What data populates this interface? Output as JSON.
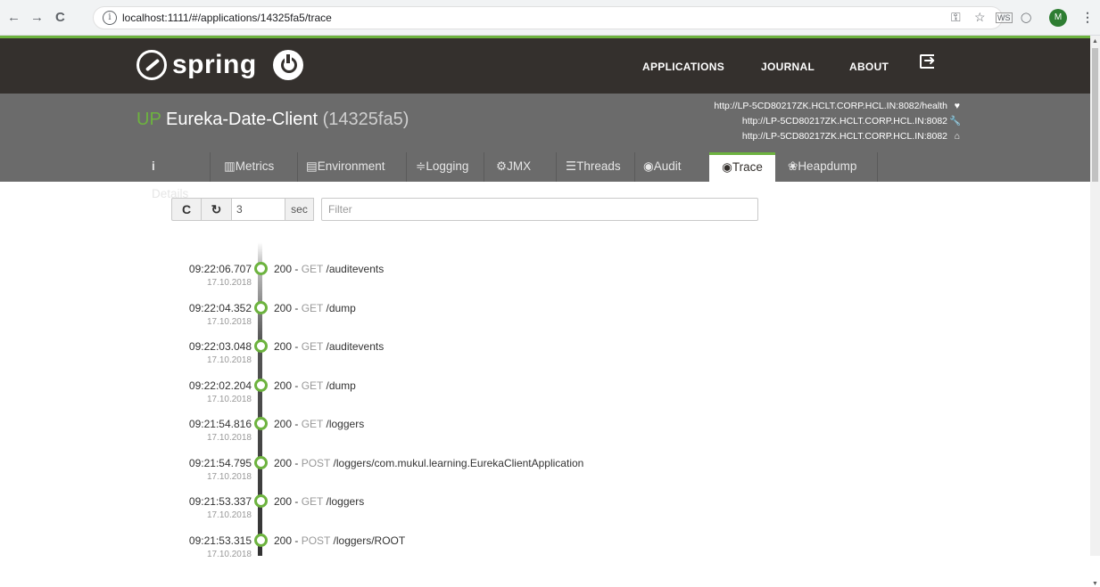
{
  "browser": {
    "back": "←",
    "forward": "→",
    "reload": "C",
    "info": "i",
    "url": "localhost:1111/#/applications/14325fa5/trace",
    "key_icon": "⚿",
    "star_icon": "☆",
    "ext1": "WS",
    "ext2": "◯",
    "avatar": "M",
    "menu_icon": "⋮"
  },
  "header": {
    "logo_text": "spring",
    "menu": [
      "APPLICATIONS",
      "JOURNAL",
      "ABOUT"
    ]
  },
  "app": {
    "status": "UP",
    "name": "Eureka-Date-Client",
    "id": "(14325fa5)",
    "urls": [
      {
        "text": "http://LP-5CD80217ZK.HCLT.CORP.HCL.IN:8082/health",
        "icon": "♥"
      },
      {
        "text": "http://LP-5CD80217ZK.HCLT.CORP.HCL.IN:8082",
        "icon": "🔧"
      },
      {
        "text": "http://LP-5CD80217ZK.HCLT.CORP.HCL.IN:8082",
        "icon": "⌂"
      }
    ]
  },
  "tabs": [
    {
      "icon": "i",
      "label": "Details"
    },
    {
      "icon": "▥",
      "label": "Metrics"
    },
    {
      "icon": "▤",
      "label": "Environment"
    },
    {
      "icon": "≑",
      "label": "Logging"
    },
    {
      "icon": "⚙",
      "label": "JMX"
    },
    {
      "icon": "☰",
      "label": "Threads"
    },
    {
      "icon": "◉",
      "label": "Audit"
    },
    {
      "icon": "◉",
      "label": "Trace"
    },
    {
      "icon": "❀",
      "label": "Heapdump"
    }
  ],
  "toolbar": {
    "refresh_icon": "C",
    "auto_icon": "↻",
    "interval": "3",
    "unit": "sec",
    "filter_placeholder": "Filter"
  },
  "traces": [
    {
      "time": "09:22:06.707",
      "date": "17.10.2018",
      "status": "200",
      "method": "GET",
      "path": "/auditevents"
    },
    {
      "time": "09:22:04.352",
      "date": "17.10.2018",
      "status": "200",
      "method": "GET",
      "path": "/dump"
    },
    {
      "time": "09:22:03.048",
      "date": "17.10.2018",
      "status": "200",
      "method": "GET",
      "path": "/auditevents"
    },
    {
      "time": "09:22:02.204",
      "date": "17.10.2018",
      "status": "200",
      "method": "GET",
      "path": "/dump"
    },
    {
      "time": "09:21:54.816",
      "date": "17.10.2018",
      "status": "200",
      "method": "GET",
      "path": "/loggers"
    },
    {
      "time": "09:21:54.795",
      "date": "17.10.2018",
      "status": "200",
      "method": "POST",
      "path": "/loggers/com.mukul.learning.EurekaClientApplication"
    },
    {
      "time": "09:21:53.337",
      "date": "17.10.2018",
      "status": "200",
      "method": "GET",
      "path": "/loggers"
    },
    {
      "time": "09:21:53.315",
      "date": "17.10.2018",
      "status": "200",
      "method": "POST",
      "path": "/loggers/ROOT"
    }
  ]
}
